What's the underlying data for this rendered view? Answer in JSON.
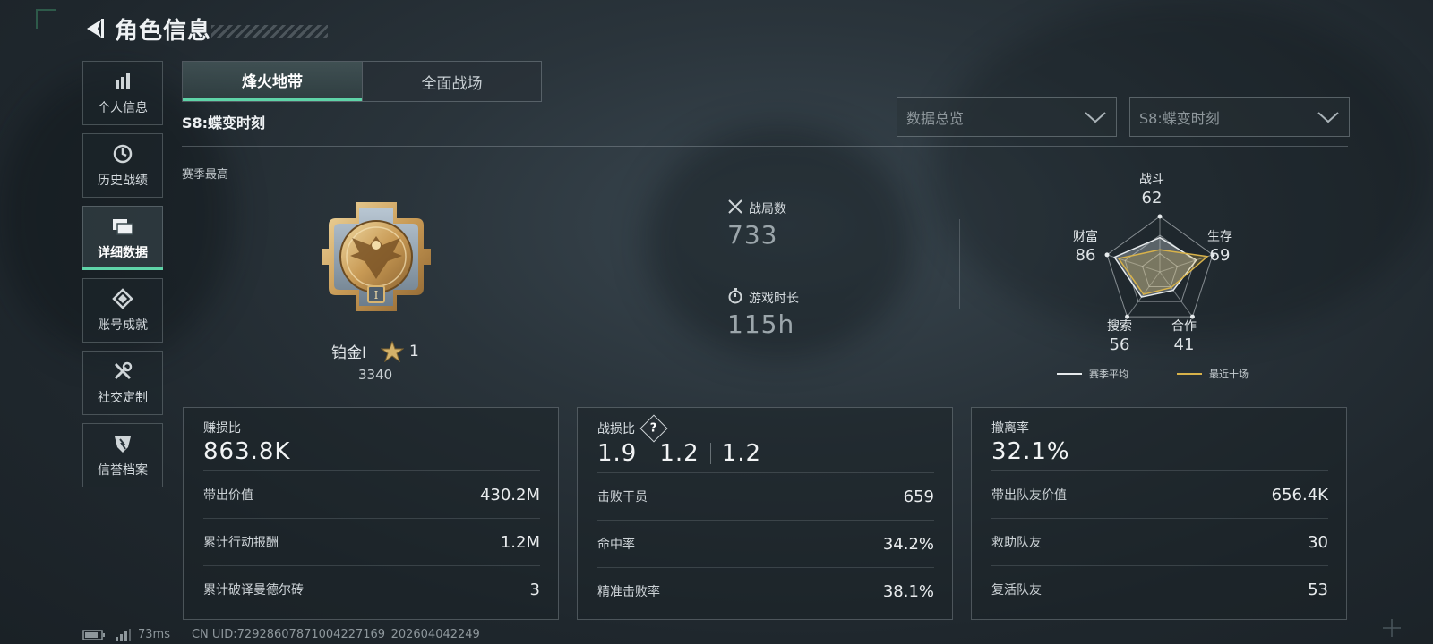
{
  "header": {
    "title": "角色信息"
  },
  "sidebar": {
    "items": [
      {
        "label": "个人信息",
        "icon": "bar-chart-icon"
      },
      {
        "label": "历史战绩",
        "icon": "clock-icon"
      },
      {
        "label": "详细数据",
        "icon": "folders-icon",
        "active": true
      },
      {
        "label": "账号成就",
        "icon": "achievement-icon"
      },
      {
        "label": "社交定制",
        "icon": "tools-icon"
      },
      {
        "label": "信誉档案",
        "icon": "shield-badge-icon"
      }
    ]
  },
  "tabs": [
    {
      "label": "烽火地带",
      "active": true
    },
    {
      "label": "全面战场",
      "active": false
    }
  ],
  "season_label": "S8:蝶变时刻",
  "filters": {
    "data_select": "数据总览",
    "season_select": "S8:蝶变时刻"
  },
  "season_high": {
    "label": "赛季最高",
    "rank_name": "铂金Ⅰ",
    "stars": "1",
    "points": "3340"
  },
  "summary": {
    "matches_label": "战局数",
    "matches_value": "733",
    "playtime_label": "游戏时长",
    "playtime_value": "115h"
  },
  "radar": {
    "axes": [
      {
        "label": "战斗",
        "value": "62"
      },
      {
        "label": "生存",
        "value": "69"
      },
      {
        "label": "合作",
        "value": "41"
      },
      {
        "label": "搜索",
        "value": "56"
      },
      {
        "label": "财富",
        "value": "86"
      }
    ],
    "season_avg": [
      62,
      69,
      41,
      56,
      86
    ],
    "recent10": [
      40,
      90,
      35,
      50,
      78
    ],
    "legend": {
      "avg": "赛季平均",
      "recent": "最近十场"
    },
    "colors": {
      "avg": "#e6eaec",
      "recent": "#d8b24a"
    }
  },
  "cards": {
    "profit": {
      "label": "赚损比",
      "value": "863.8K",
      "rows": [
        {
          "label": "带出价值",
          "value": "430.2M"
        },
        {
          "label": "累计行动报酬",
          "value": "1.2M"
        },
        {
          "label": "累计破译曼德尔砖",
          "value": "3"
        }
      ]
    },
    "combat": {
      "label": "战损比",
      "help": "?",
      "values": [
        "1.9",
        "1.2",
        "1.2"
      ],
      "rows": [
        {
          "label": "击败干员",
          "value": "659"
        },
        {
          "label": "命中率",
          "value": "34.2%"
        },
        {
          "label": "精准击败率",
          "value": "38.1%"
        }
      ]
    },
    "extract": {
      "label": "撤离率",
      "value": "32.1%",
      "rows": [
        {
          "label": "带出队友价值",
          "value": "656.4K"
        },
        {
          "label": "救助队友",
          "value": "30"
        },
        {
          "label": "复活队友",
          "value": "53"
        }
      ]
    }
  },
  "status": {
    "ping": "73ms",
    "uid": "CN UID:7292860787100422716​9_202604042249"
  },
  "accent": "#5fd4a8"
}
